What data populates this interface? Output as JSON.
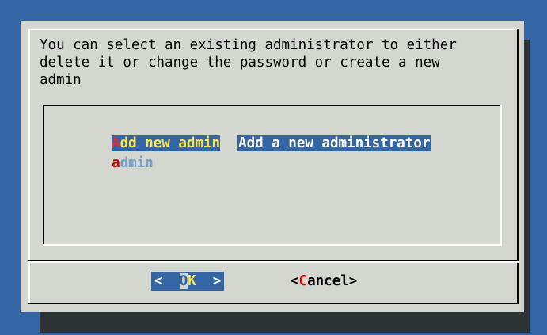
{
  "prompt": "You can select an existing administrator to either\ndelete it or change the password or create a new\nadmin",
  "menu": {
    "items": [
      {
        "tag_first": "A",
        "tag_rest": "dd new admin",
        "item": "Add a new administrator",
        "selected": true
      },
      {
        "tag_first": "a",
        "tag_rest": "dmin",
        "item": "",
        "selected": false
      }
    ]
  },
  "buttons": {
    "ok": {
      "left": "<",
      "o": "O",
      "k": "K",
      "right": ">"
    },
    "cancel": {
      "lt": "<",
      "hot": "C",
      "rest": "ancel",
      "gt": ">"
    }
  },
  "colors": {
    "background": "#3465a4",
    "dialog": "#d3d7cf",
    "selection": "#3465a4",
    "hotkey": "#cc0000",
    "highlight_text": "#fce94f"
  }
}
